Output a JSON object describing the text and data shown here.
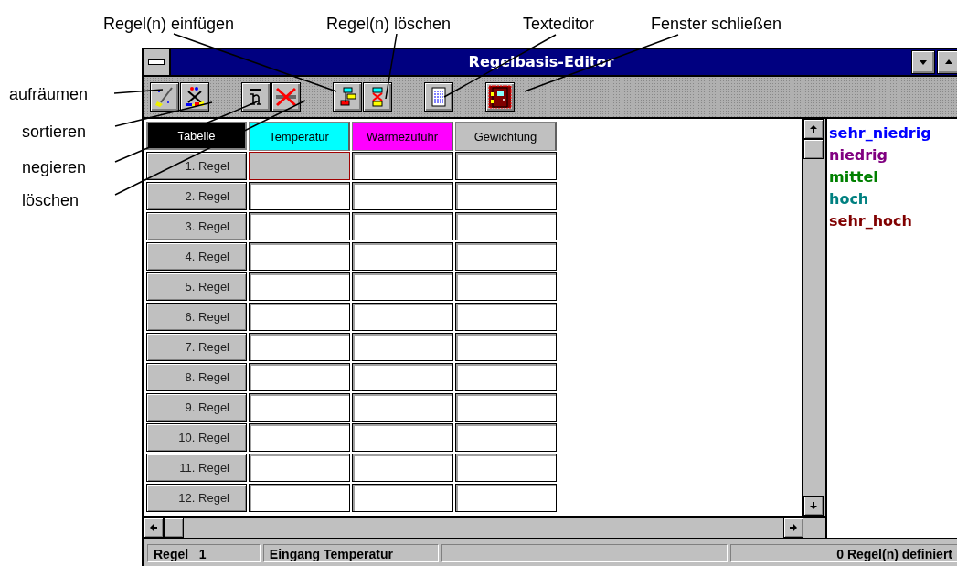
{
  "annotations": [
    {
      "label": "Regel(n) einfügen"
    },
    {
      "label": "Regel(n) löschen"
    },
    {
      "label": "Texteditor"
    },
    {
      "label": "Fenster schließen"
    },
    {
      "label": "aufräumen"
    },
    {
      "label": "sortieren"
    },
    {
      "label": "negieren"
    },
    {
      "label": "löschen"
    }
  ],
  "window": {
    "title": "Regelbasis-Editor"
  },
  "table": {
    "corner": "Tabelle",
    "columns": [
      {
        "label": "Temperatur",
        "color": "#00ffff"
      },
      {
        "label": "Wärmezufuhr",
        "color": "#ff00ff"
      },
      {
        "label": "Gewichtung",
        "color": "#c0c0c0"
      }
    ],
    "rows": [
      {
        "label": "1. Regel",
        "selected": true
      },
      {
        "label": "2. Regel",
        "selected": false
      },
      {
        "label": "3. Regel",
        "selected": false
      },
      {
        "label": "4. Regel",
        "selected": false
      },
      {
        "label": "5. Regel",
        "selected": false
      },
      {
        "label": "6. Regel",
        "selected": false
      },
      {
        "label": "7. Regel",
        "selected": false
      },
      {
        "label": "8. Regel",
        "selected": false
      },
      {
        "label": "9. Regel",
        "selected": false
      },
      {
        "label": "10. Regel",
        "selected": false
      },
      {
        "label": "11. Regel",
        "selected": false
      },
      {
        "label": "12. Regel",
        "selected": false
      }
    ]
  },
  "terms": [
    {
      "label": "sehr_niedrig",
      "color": "#0000ff"
    },
    {
      "label": "niedrig",
      "color": "#800080"
    },
    {
      "label": "mittel",
      "color": "#008000"
    },
    {
      "label": "hoch",
      "color": "#008080"
    },
    {
      "label": "sehr_hoch",
      "color": "#800000"
    }
  ],
  "status_bar": {
    "rule": "Regel   1",
    "input": "Eingang Temperatur",
    "count": "0 Regel(n) definiert"
  }
}
